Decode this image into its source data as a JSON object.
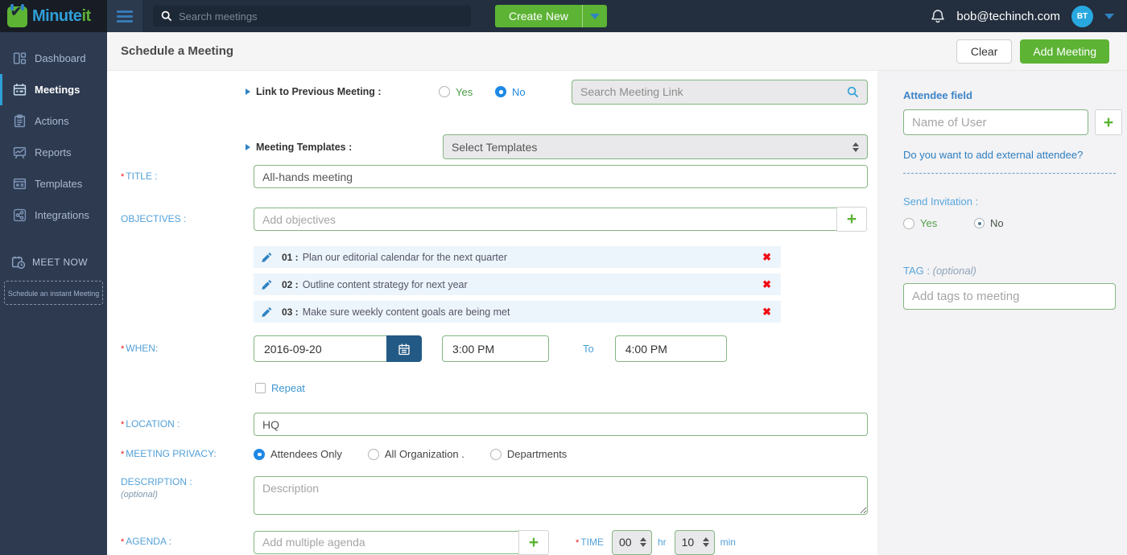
{
  "colors": {
    "topbar": "#232e3e",
    "logo-bg": "#181c24",
    "sidebar": "#2d3a50",
    "green": "#5cb334",
    "blue": "#2f9fd8",
    "link-blue": "#2d7fc1",
    "label-blue": "#53a0d8",
    "input-border": "#83b683",
    "red": "#e81515",
    "row-bg": "#edf5fc",
    "panel-bg": "#f3f2f4",
    "header-bg": "#f5f5f6",
    "date-btn": "#235a85",
    "avatar-blue": "#29a8e0"
  },
  "icons": {
    "plus": "+",
    "close": "✖",
    "check": "✔",
    "required": "*"
  },
  "topbar": {
    "brand_primary": "Minute",
    "brand_secondary": "it",
    "search_placeholder": "Search meetings",
    "create_new_label": "Create New",
    "user_email": "bob@techinch.com",
    "avatar_initials": "BT"
  },
  "sidebar": {
    "items": [
      {
        "label": "Dashboard"
      },
      {
        "label": "Meetings"
      },
      {
        "label": "Actions"
      },
      {
        "label": "Reports"
      },
      {
        "label": "Templates"
      },
      {
        "label": "Integrations"
      }
    ],
    "meet_now_label": "MEET NOW",
    "instant_meeting_label": "Schedule an instant Meeting"
  },
  "header": {
    "title": "Schedule a Meeting",
    "clear_label": "Clear",
    "add_meeting_label": "Add Meeting"
  },
  "form": {
    "link_previous": {
      "label": "Link to Previous Meeting :",
      "yes_label": "Yes",
      "no_label": "No",
      "selected": "No",
      "search_placeholder": "Search Meeting Link"
    },
    "templates": {
      "label": "Meeting Templates :",
      "selected_option": "Select Templates"
    },
    "title": {
      "label": "TITLE :",
      "value": "All-hands meeting"
    },
    "objectives": {
      "label": "OBJECTIVES :",
      "placeholder": "Add objectives",
      "items": [
        {
          "num": "01 :",
          "text": "Plan our editorial calendar for the next quarter"
        },
        {
          "num": "02 :",
          "text": "Outline content strategy for next year"
        },
        {
          "num": "03 :",
          "text": "Make sure weekly content goals are being met"
        }
      ]
    },
    "when": {
      "label": "WHEN:",
      "date": "2016-09-20",
      "start_time": "3:00 PM",
      "to_label": "To",
      "end_time": "4:00 PM",
      "repeat_label": "Repeat"
    },
    "location": {
      "label": "LOCATION :",
      "value": "HQ"
    },
    "privacy": {
      "label": "MEETING PRIVACY:",
      "options": [
        {
          "label": "Attendees Only",
          "selected": true
        },
        {
          "label": "All Organization .",
          "selected": false
        },
        {
          "label": "Departments",
          "selected": false
        }
      ]
    },
    "description": {
      "label": "DESCRIPTION :",
      "optional_note": "(optional)",
      "placeholder": "Description"
    },
    "agenda": {
      "label": "AGENDA :",
      "placeholder": "Add multiple agenda",
      "time_label": "TIME",
      "hours_value": "00",
      "hours_unit": "hr",
      "minutes_value": "10",
      "minutes_unit": "min"
    }
  },
  "attendee_panel": {
    "title": "Attendee field",
    "name_placeholder": "Name of User",
    "external_link": "Do you want to add external attendee?",
    "send_invitation_label": "Send Invitation :",
    "yes_label": "Yes",
    "no_label": "No",
    "selected": "No",
    "tag_label": "TAG :",
    "tag_optional": "(optional)",
    "tag_placeholder": "Add tags to meeting"
  }
}
